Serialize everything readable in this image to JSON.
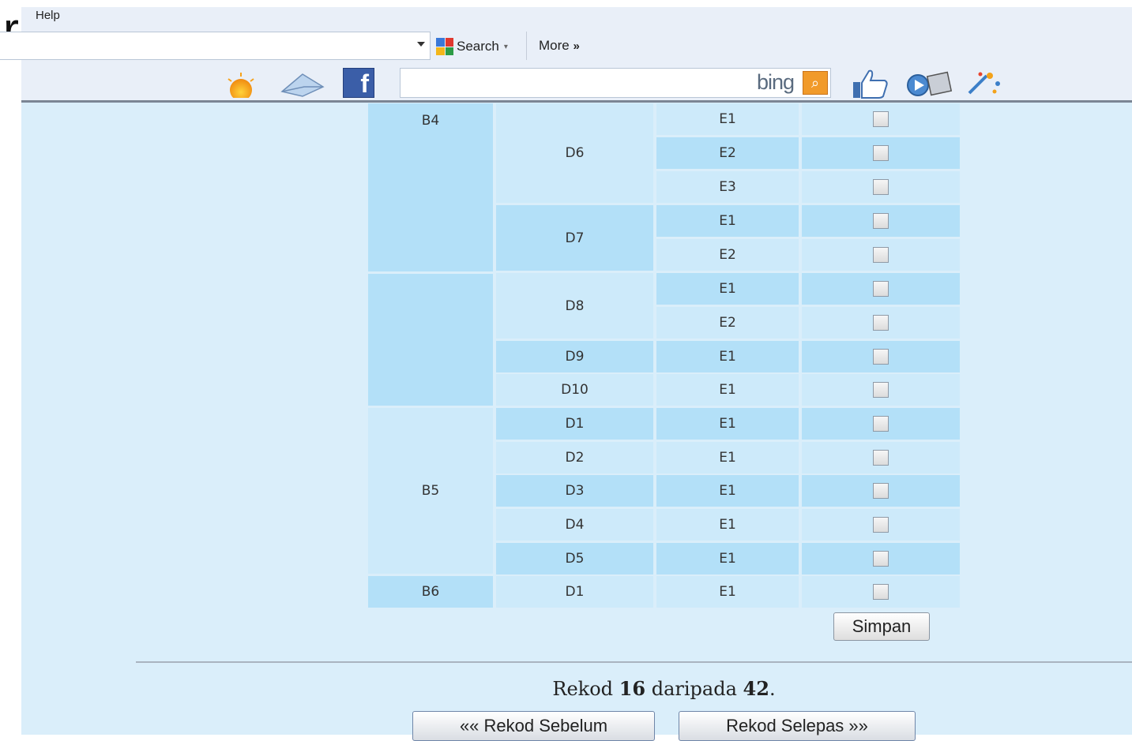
{
  "header": {
    "cut_title_letter": "r",
    "menu_help": "Help"
  },
  "toolbar": {
    "search_label": "Search",
    "more_label": "More",
    "more_glyph": "»",
    "bing_label": "bing",
    "search_input_value": "",
    "bing_input_value": ""
  },
  "icons": [
    "sun-icon",
    "mail-icon",
    "facebook-icon",
    "bing-search-icon",
    "like-icon",
    "film-icon",
    "spark-icon"
  ],
  "colors": {
    "page_bg": "#daeefa",
    "row_dark": "#b3e0f8",
    "row_light": "#cdeafa",
    "bing_button": "#f19a2a",
    "facebook": "#3b5ea8"
  },
  "table": {
    "col_b": [
      {
        "label": "B4"
      },
      {
        "label": ""
      },
      {
        "label": "B5"
      },
      {
        "label": "B6"
      }
    ],
    "col_d": [
      {
        "label": "D6"
      },
      {
        "label": "D7"
      },
      {
        "label": "D8"
      },
      {
        "label": "D9"
      },
      {
        "label": "D10"
      },
      {
        "label": "D1"
      },
      {
        "label": "D2"
      },
      {
        "label": "D3"
      },
      {
        "label": "D4"
      },
      {
        "label": "D5"
      },
      {
        "label": "D1"
      }
    ],
    "rows": [
      {
        "e": "E1",
        "checked": false
      },
      {
        "e": "E2",
        "checked": false
      },
      {
        "e": "E3",
        "checked": false
      },
      {
        "e": "E1",
        "checked": false
      },
      {
        "e": "E2",
        "checked": false
      },
      {
        "e": "E1",
        "checked": false
      },
      {
        "e": "E2",
        "checked": false
      },
      {
        "e": "E1",
        "checked": false
      },
      {
        "e": "E1",
        "checked": false
      },
      {
        "e": "E1",
        "checked": false
      },
      {
        "e": "E1",
        "checked": false
      },
      {
        "e": "E1",
        "checked": false
      },
      {
        "e": "E1",
        "checked": false
      },
      {
        "e": "E1",
        "checked": false
      },
      {
        "e": "E1",
        "checked": false
      }
    ]
  },
  "form": {
    "save_label": "Simpan"
  },
  "pager": {
    "prefix": "Rekod",
    "current": "16",
    "middle": "daripada",
    "total": "42",
    "suffix": ".",
    "prev_label": "«« Rekod Sebelum",
    "next_label": "Rekod Selepas »»"
  }
}
